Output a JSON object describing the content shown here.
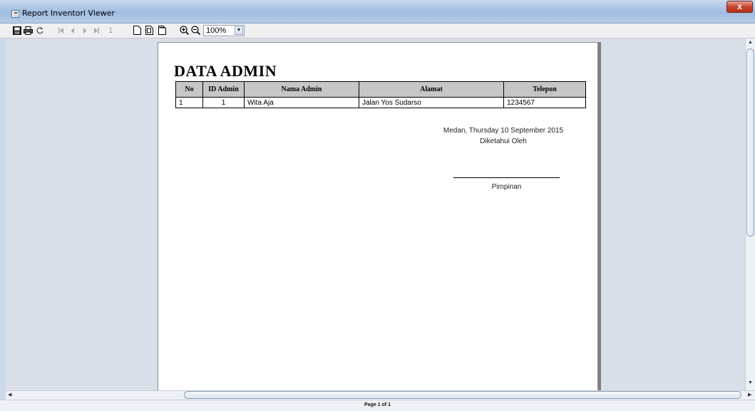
{
  "window": {
    "title": "Report Inventori Viewer",
    "close_label": "x"
  },
  "toolbar": {
    "icons": [
      "save-icon",
      "print-icon",
      "reload-icon",
      "first-page-icon",
      "previous-page-icon",
      "next-page-icon",
      "last-page-icon",
      "actual-size-icon",
      "fit-page-icon",
      "fit-width-icon",
      "zoom-in-icon",
      "zoom-out-icon"
    ],
    "page_number": "1",
    "zoom_value": "100%"
  },
  "report": {
    "title": "DATA ADMIN",
    "columns": [
      "No",
      "ID Admin",
      "Nama Admin",
      "Alamat",
      "Telepon"
    ],
    "rows": [
      {
        "no": "1",
        "id_admin": "1",
        "nama_admin": "Wita Aja",
        "alamat": "Jalan Yos Sudarso",
        "telepon": "1234567"
      }
    ],
    "signature": {
      "place_date": "Medan, Thursday 10 September 2015",
      "known_by": "Diketahui Oleh",
      "name": "Pimpinan"
    }
  },
  "status": {
    "page_info": "Page 1 of 1"
  },
  "colors": {
    "titlebar": "#9fbbe0",
    "viewer_background": "#d8dfe9",
    "table_header": "#c6c6c6"
  }
}
